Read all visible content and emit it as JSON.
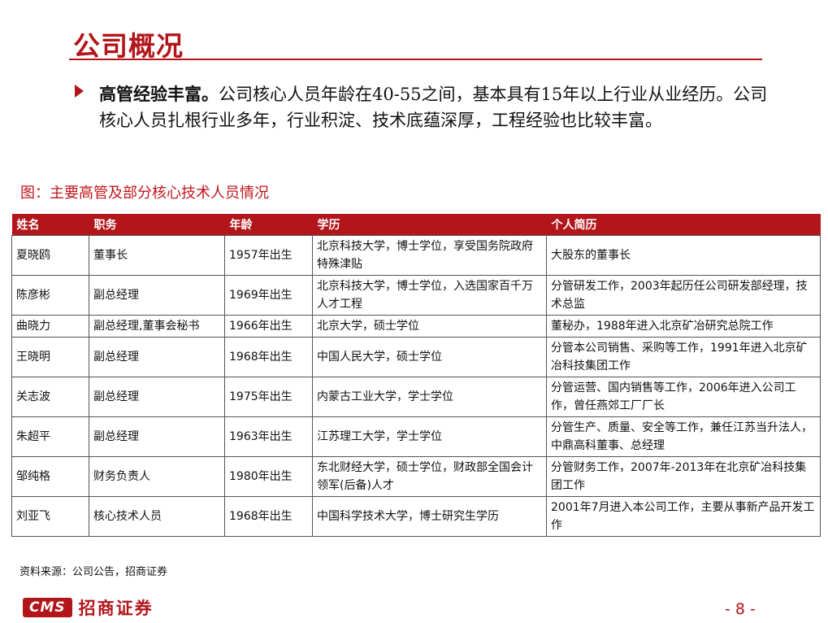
{
  "slide": {
    "title": "公司概况",
    "bullet_bold": "高管经验丰富。",
    "bullet_rest": "公司核心人员年龄在40-55之间，基本具有15年以上行业从业经历。公司核心人员扎根行业多年，行业积淀、技术底蕴深厚，工程经验也比较丰富。",
    "figure_caption": "图：主要高管及部分核心技术人员情况",
    "source": "资料来源：公司公告，招商证券",
    "page_number": "- 8 -"
  },
  "table": {
    "headers": [
      "姓名",
      "职务",
      "年龄",
      "学历",
      "个人简历"
    ],
    "rows": [
      [
        "夏晓鸥",
        "董事长",
        "1957年出生",
        "北京科技大学，博士学位，享受国务院政府特殊津贴",
        "大股东的董事长"
      ],
      [
        "陈彦彬",
        "副总经理",
        "1969年出生",
        "北京科技大学，博士学位，入选国家百千万人才工程",
        "分管研发工作，2003年起历任公司研发部经理，技术总监"
      ],
      [
        "曲晓力",
        "副总经理,董事会秘书",
        "1966年出生",
        "北京大学，硕士学位",
        "董秘办，1988年进入北京矿冶研究总院工作"
      ],
      [
        "王晓明",
        "副总经理",
        "1968年出生",
        "中国人民大学，硕士学位",
        "分管本公司销售、采购等工作，1991年进入北京矿冶科技集团工作"
      ],
      [
        "关志波",
        "副总经理",
        "1975年出生",
        "内蒙古工业大学，学士学位",
        "分管运营、国内销售等工作，2006年进入公司工作，曾任燕郊工厂厂长"
      ],
      [
        "朱超平",
        "副总经理",
        "1963年出生",
        "江苏理工大学，学士学位",
        "分管生产、质量、安全等工作，兼任江苏当升法人，中鼎高科董事、总经理"
      ],
      [
        "邹纯格",
        "财务负责人",
        "1980年出生",
        "东北财经大学，硕士学位，财政部全国会计领军(后备)人才",
        "分管财务工作，2007年-2013年在北京矿冶科技集团工作"
      ],
      [
        "刘亚飞",
        "核心技术人员",
        "1968年出生",
        "中国科学技术大学，博士研究生学历",
        "2001年7月进入本公司工作，主要从事新产品开发工作"
      ]
    ]
  },
  "footer": {
    "logo_badge": "CMS",
    "logo_text": "招商证券"
  }
}
